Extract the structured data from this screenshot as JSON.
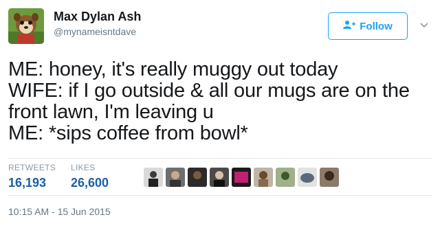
{
  "user": {
    "name": "Max Dylan Ash",
    "handle": "@mynameisntdave"
  },
  "follow_button": {
    "label": "Follow",
    "icon": "add-user-icon"
  },
  "tweet": {
    "text": "ME: honey, it's really muggy out today\nWIFE: if I go outside & all our mugs are on the front lawn, I'm leaving u\nME: *sips coffee from bowl*"
  },
  "stats": {
    "retweets_label": "RETWEETS",
    "retweets_value": "16,193",
    "likes_label": "LIKES",
    "likes_value": "26,600"
  },
  "timestamp": "10:15 AM - 15 Jun 2015",
  "colors": {
    "accent": "#1da1f2",
    "stat_value": "#1b5fa8",
    "text": "#14171a",
    "muted": "#657786"
  }
}
